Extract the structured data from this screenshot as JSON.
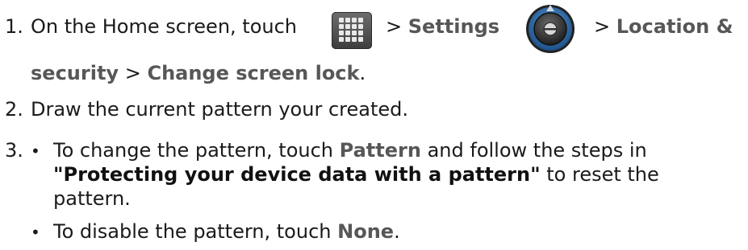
{
  "steps": [
    {
      "number": "1.",
      "line1": {
        "t1": "On the Home screen, touch",
        "sep1": ">",
        "settings": "Settings",
        "sep2": ">",
        "location": "Location &"
      },
      "line2": {
        "security": "security",
        "sep": ">",
        "change_lock": "Change screen lock",
        "end": "."
      }
    },
    {
      "number": "2.",
      "text": "Draw the current pattern your created."
    },
    {
      "number": "3.",
      "bullets": [
        {
          "bullet": "•",
          "l1_a": "To change the pattern, touch",
          "l1_pattern": "Pattern",
          "l1_b": "and follow the steps in",
          "l2_ref": "\"Protecting your device data with a pattern\"",
          "l2_b": "to reset the",
          "l3": "pattern."
        },
        {
          "bullet": "•",
          "a": "To disable the pattern, touch",
          "none": "None",
          "end": "."
        }
      ]
    }
  ],
  "icons": {
    "apps": "apps-grid-icon",
    "settings": "settings-knob-icon"
  },
  "colors": {
    "ui_text": "#575757",
    "body_text": "#1a1a1a",
    "knob_ring": "#2f79c7"
  }
}
